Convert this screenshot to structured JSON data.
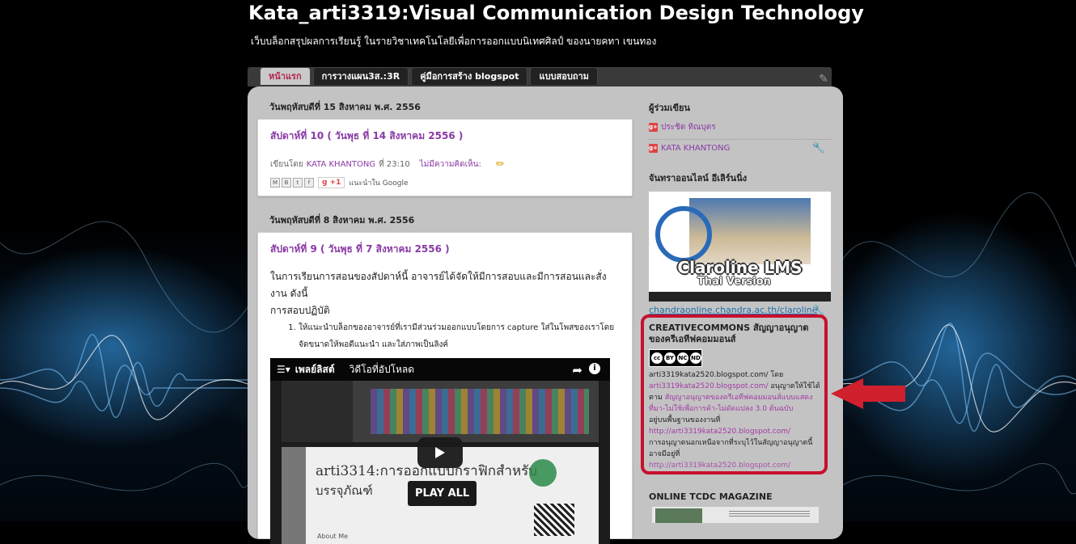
{
  "blog": {
    "title": "Kata_arti3319:Visual Communication Design Technology",
    "description": "เว็บบล็อกสรุปผลการเรียนรู้ ในรายวิชาเทคโนโลยีเพื่อการออกแบบนิเทศศิลป์ ของนายคทา เขนทอง"
  },
  "tabs": [
    {
      "label": "หน้าแรก",
      "active": true
    },
    {
      "label": "การวางแผน3ส.:3R",
      "active": false
    },
    {
      "label": "คู่มือการสร้าง blogspot",
      "active": false
    },
    {
      "label": "แบบสอบถาม",
      "active": false
    }
  ],
  "posts": [
    {
      "date": "วันพฤหัสบดีที่ 15 สิงหาคม พ.ศ. 2556",
      "title": "สัปดาห์ที่ 10 ( วันพุธ ที่ 14 สิงหาคม 2556 )",
      "footer": {
        "posted_by_prefix": "เขียนโดย",
        "author": "KATA KHANTONG",
        "time": "ที่ 23:10",
        "comments": "ไม่มีความคิดเห็น:"
      },
      "share": {
        "buttons": [
          "M",
          "B",
          "t",
          "f"
        ],
        "gplus_label": "+1",
        "recommend": "แนะนำใน Google"
      }
    },
    {
      "date": "วันพฤหัสบดีที่ 8 สิงหาคม พ.ศ. 2556",
      "title": "สัปดาห์ที่ 9 ( วันพุธ ที่ 7 สิงหาคม 2556 )",
      "para1": "ในการเรียนการสอนของสัปดาห์นี้  อาจารย์ได้จัดให้มีการสอบและมีการสอนและสั่งงาน ดังนี้",
      "para2": "การสอบปฏิบัติ",
      "list_item": "ให้แนะนำบล็อกของอาจารย์ที่เรามีส่วนร่วมออกแบบโดยการ capture ใส่ในโพสของเราโดยจัดขนาดให้พอดีแนะนำ และใส่ภาพเป็นลิงค์",
      "video": {
        "playlist_label": "เพลย์ลิสต์",
        "title": "วิดีโอที่อัปโหลด",
        "thumb_text_1": "arti3314:การออกแบบกราฟิกสำหรับ",
        "thumb_text_2": "บรรจุภัณฑ์",
        "about": "About Me",
        "play_all": "PLAY ALL"
      }
    }
  ],
  "sidebar": {
    "contributors_title": "ผู้ร่วมเขียน",
    "contributors": [
      "ประชิด ทิณบุตร",
      "KATA KHANTONG"
    ],
    "claroline_title": "จันทราออนไลน์ อีเลิร์นนิ่ง",
    "claroline_image_text": "Claroline LMS",
    "claroline_image_sub": "Thai Version",
    "claroline_link": "chandraonline.chandra.ac.th/claroline",
    "cc": {
      "title": "CREATIVECOMMONS สัญญาอนุญาตของครีเอทีฟคอมมอนส์",
      "badge": [
        "cc",
        "BY",
        "NC",
        "ND"
      ],
      "line1": "arti3319kata2520.blogspot.com/ โดย",
      "link1": "arti3319kata2520.blogspot.com/",
      "text2": "อนุญาตให้ใช้ได้ตาม",
      "link2": "สัญญาอนุญาตของครีเอทีฟคอมมอนส์แบบแสดงที่มา-ไม่ใช้เพื่อการค้า-ไม่ดัดแปลง 3.0 ต้นฉบับ",
      "text3": "อยู่บนพื้นฐานของงานที่",
      "link3": "http://arti3319kata2520.blogspot.com/",
      "text4": "การอนุญาตนอกเหนือจากที่ระบุไว้ในสัญญาอนุญาตนี้อาจมีอยู่ที่",
      "link4": "http://arti3319kata2520.blogspot.com/"
    },
    "tcdc_title": "ONLINE TCDC MAGAZINE"
  },
  "colors": {
    "link_purple": "#8a3aa5",
    "highlight_red": "#c8102e",
    "container_gray": "#c3c3c3"
  }
}
